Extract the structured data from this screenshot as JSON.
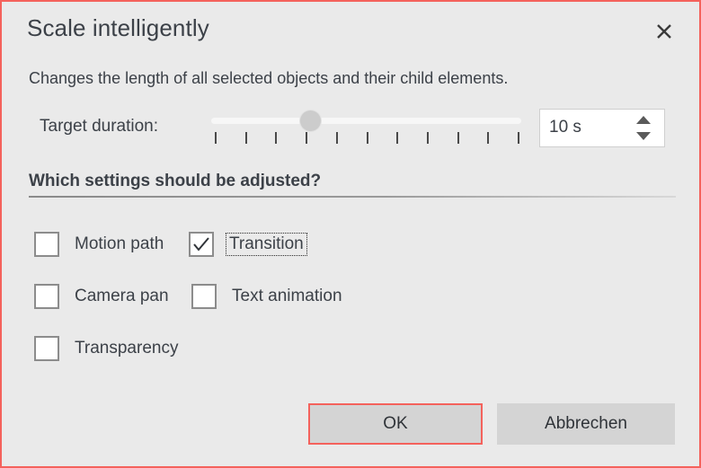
{
  "dialog": {
    "title": "Scale intelligently",
    "description": "Changes the length of all selected objects and their child elements.",
    "close_icon": "close-icon",
    "border_color": "#f4625c",
    "background_color": "#eaeaea"
  },
  "duration": {
    "label": "Target duration:",
    "value": "10 s",
    "slider": {
      "min": 0,
      "max": 10,
      "value": 3,
      "tick_count": 11,
      "thumb_percent": 32
    },
    "spinner_up_icon": "triangle-up-icon",
    "spinner_down_icon": "triangle-down-icon"
  },
  "settings": {
    "header": "Which settings should be adjusted?",
    "options": [
      {
        "label": "Motion path",
        "checked": false,
        "focused": false
      },
      {
        "label": "Transition",
        "checked": true,
        "focused": true
      },
      {
        "label": "Camera pan",
        "checked": false,
        "focused": false
      },
      {
        "label": "Text animation",
        "checked": false,
        "focused": false
      },
      {
        "label": "Transparency",
        "checked": false,
        "focused": false
      }
    ]
  },
  "buttons": {
    "ok": "OK",
    "cancel": "Abbrechen",
    "ok_highlight_color": "#f4625c"
  }
}
